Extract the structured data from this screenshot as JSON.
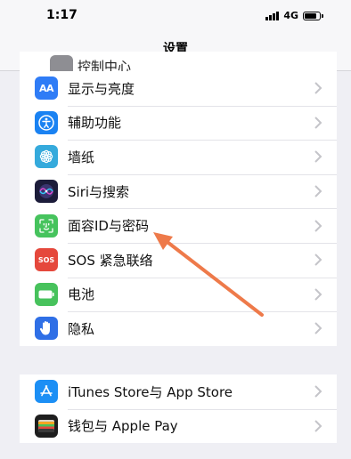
{
  "status": {
    "time": "1:17",
    "network": "4G"
  },
  "nav": {
    "title": "设置"
  },
  "peek_item": {
    "label": "控制中心"
  },
  "colors": {
    "display": "#2f7cf6",
    "accessibility": "#1a82f2",
    "wallpaper": "#35aadc",
    "siri": "#3a3570",
    "faceid": "#46c35d",
    "sos": "#e5483c",
    "battery": "#47c25c",
    "privacy": "#2f6fe6",
    "appstore": "#1c8ff5",
    "wallet": "#1e1e1e",
    "arrow": "#ee7a4a"
  },
  "group1": [
    {
      "id": "display",
      "label": "显示与亮度",
      "icon": "text-size-icon",
      "icon_text": "AA"
    },
    {
      "id": "accessibility",
      "label": "辅助功能",
      "icon": "accessibility-icon"
    },
    {
      "id": "wallpaper",
      "label": "墙纸",
      "icon": "wallpaper-flower-icon"
    },
    {
      "id": "siri",
      "label": "Siri与搜索",
      "icon": "siri-icon"
    },
    {
      "id": "faceid",
      "label": "面容ID与密码",
      "icon": "face-id-icon"
    },
    {
      "id": "sos",
      "label": "SOS 紧急联络",
      "icon": "sos-icon",
      "icon_text": "SOS"
    },
    {
      "id": "battery",
      "label": "电池",
      "icon": "battery-icon"
    },
    {
      "id": "privacy",
      "label": "隐私",
      "icon": "hand-icon"
    }
  ],
  "group2": [
    {
      "id": "appstore",
      "label": "iTunes Store与 App Store",
      "icon": "app-store-icon"
    },
    {
      "id": "wallet",
      "label": "钱包与 Apple Pay",
      "icon": "wallet-icon"
    }
  ]
}
